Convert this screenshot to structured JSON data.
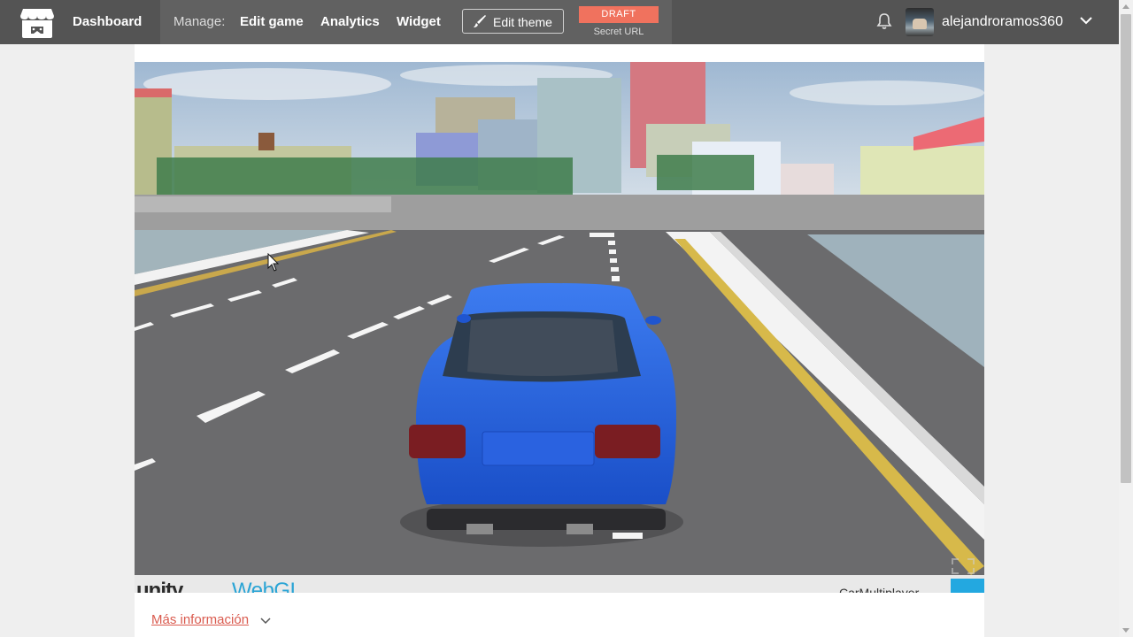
{
  "header": {
    "dashboard_label": "Dashboard",
    "manage_label": "Manage:",
    "links": [
      "Edit game",
      "Analytics",
      "Widget"
    ],
    "edit_theme_label": "Edit theme",
    "draft_badge": "DRAFT",
    "secret_url_label": "Secret URL",
    "username": "alejandroramos360"
  },
  "game": {
    "unity_logo_text": "unity",
    "unity_webgl_text": "WebGL",
    "game_title": "CarMultiplayer"
  },
  "footer": {
    "more_info_label": "Más información"
  },
  "colors": {
    "topbar": "#545454",
    "accent": "#da5b4f",
    "draft": "#f0725e",
    "car": "#1f5fdc"
  },
  "icons": [
    "itchio-logo-icon",
    "brush-icon",
    "bell-icon",
    "chevron-down-icon",
    "fullscreen-icon",
    "mouse-cursor-icon"
  ]
}
